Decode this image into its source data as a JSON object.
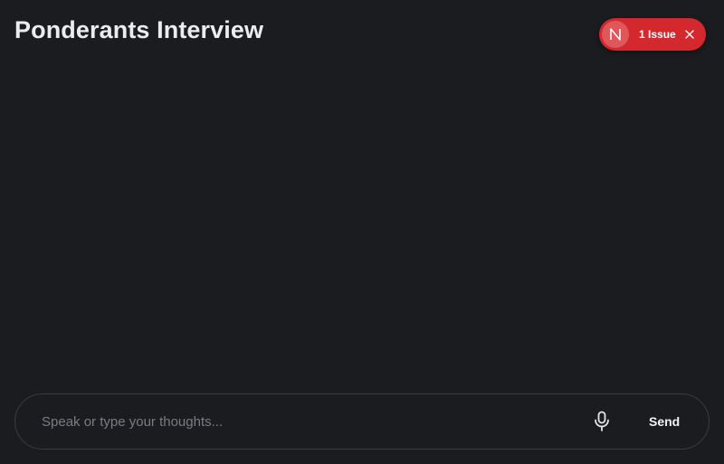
{
  "header": {
    "title": "Ponderants Interview"
  },
  "dev_overlay": {
    "badge_letter": "N",
    "badge_icon": "nextjs-logo-icon",
    "issues_label": "1 Issue",
    "close_icon": "close-icon",
    "accent_color": "#d2282e"
  },
  "composer": {
    "placeholder": "Speak or type your thoughts...",
    "value": "",
    "mic_icon": "microphone-icon",
    "send_label": "Send"
  },
  "colors": {
    "background": "#1b1c20",
    "title_text": "#ececee",
    "composer_border": "#3a3b40",
    "placeholder_text": "#7b7c82"
  }
}
